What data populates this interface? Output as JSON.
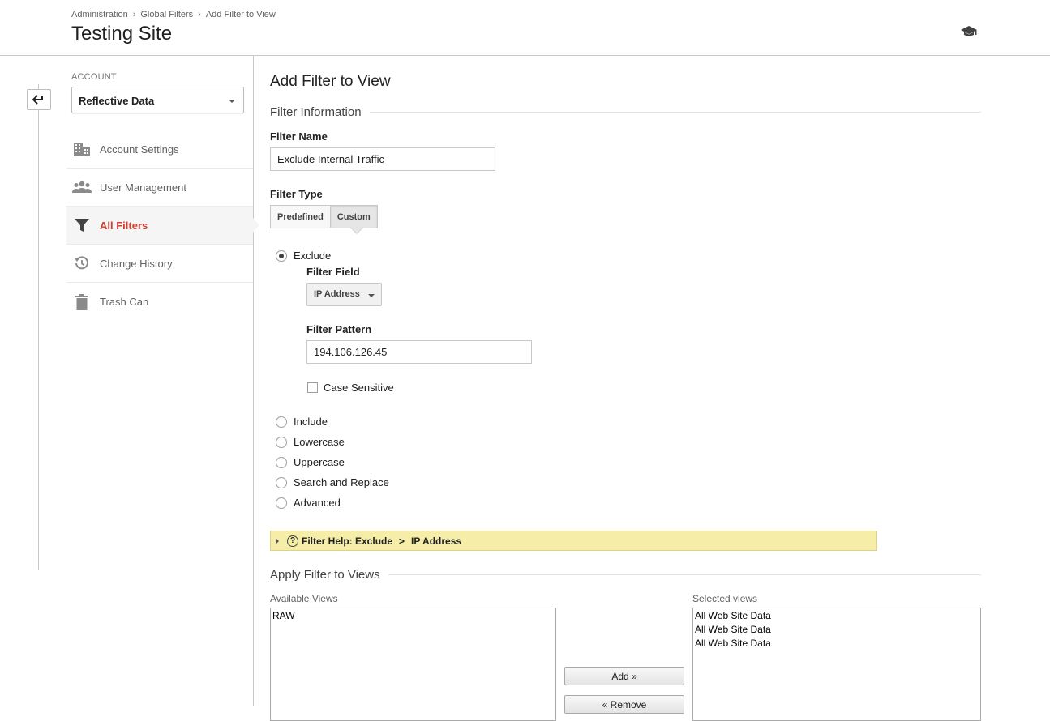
{
  "breadcrumb": [
    "Administration",
    "Global Filters",
    "Add Filter to View"
  ],
  "page_title": "Testing Site",
  "icons": {
    "help": "graduation-cap-icon",
    "back": "back-arrow-icon",
    "account_settings": "building-icon",
    "user_management": "people-icon",
    "all_filters": "funnel-icon",
    "change_history": "history-icon",
    "trash_can": "trash-icon"
  },
  "account": {
    "label": "ACCOUNT",
    "selected": "Reflective Data"
  },
  "sidebar": {
    "items": [
      {
        "label": "Account Settings",
        "active": false
      },
      {
        "label": "User Management",
        "active": false
      },
      {
        "label": "All Filters",
        "active": true
      },
      {
        "label": "Change History",
        "active": false
      },
      {
        "label": "Trash Can",
        "active": false
      }
    ]
  },
  "main": {
    "title": "Add Filter to View",
    "filter_info_title": "Filter Information",
    "filter_name_label": "Filter Name",
    "filter_name_value": "Exclude Internal Traffic",
    "filter_type_label": "Filter Type",
    "filter_type_options": [
      "Predefined",
      "Custom"
    ],
    "filter_type_selected": "Custom",
    "radio_options": [
      "Exclude",
      "Include",
      "Lowercase",
      "Uppercase",
      "Search and Replace",
      "Advanced"
    ],
    "radio_selected": "Exclude",
    "filter_field_label": "Filter Field",
    "filter_field_value": "IP Address",
    "filter_pattern_label": "Filter Pattern",
    "filter_pattern_value": "194.106.126.45",
    "case_sensitive_label": "Case Sensitive",
    "case_sensitive_checked": false,
    "help": {
      "prefix": "Filter Help: Exclude",
      "sep": ">",
      "suffix": "IP Address"
    },
    "apply_title": "Apply Filter to Views",
    "available_label": "Available Views",
    "available_views": [
      "RAW"
    ],
    "selected_label": "Selected views",
    "selected_views": [
      "All Web Site Data",
      "All Web Site Data",
      "All Web Site Data"
    ],
    "add_button": "Add »",
    "remove_button": "« Remove"
  },
  "colors": {
    "active_nav": "#d23f31",
    "help_bar": "#f6eea8",
    "divider": "#c8c8c8"
  }
}
